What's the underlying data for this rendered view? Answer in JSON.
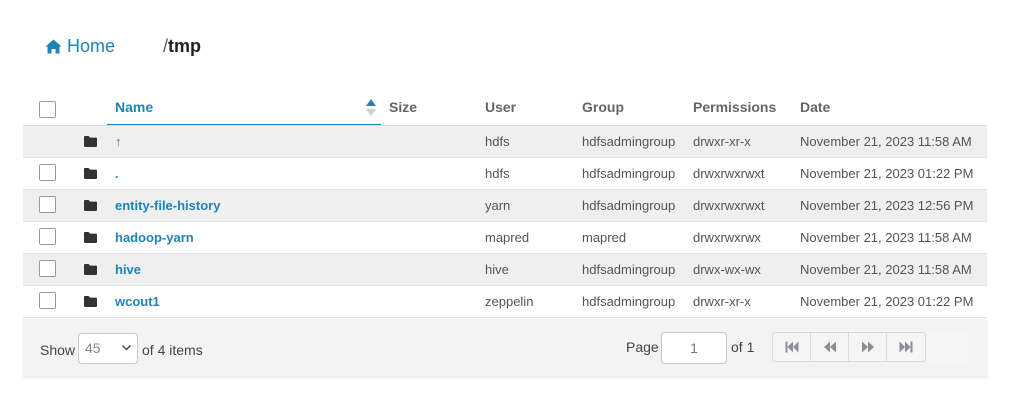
{
  "breadcrumb": {
    "home_label": "Home",
    "separator": "/",
    "current": "tmp"
  },
  "table": {
    "columns": {
      "name": "Name",
      "size": "Size",
      "user": "User",
      "group": "Group",
      "permissions": "Permissions",
      "date": "Date"
    },
    "sort": {
      "column": "Name",
      "direction": "ascending"
    },
    "rows": [
      {
        "name": "↑",
        "size": "",
        "user": "hdfs",
        "group": "hdfsadmingroup",
        "permissions": "drwxr-xr-x",
        "date": "November 21, 2023 11:58 AM",
        "type": "folder",
        "selectable": false
      },
      {
        "name": ".",
        "size": "",
        "user": "hdfs",
        "group": "hdfsadmingroup",
        "permissions": "drwxrwxrwxt",
        "date": "November 21, 2023 01:22 PM",
        "type": "folder",
        "selectable": true
      },
      {
        "name": "entity-file-history",
        "size": "",
        "user": "yarn",
        "group": "hdfsadmingroup",
        "permissions": "drwxrwxrwxt",
        "date": "November 21, 2023 12:56 PM",
        "type": "folder",
        "selectable": true
      },
      {
        "name": "hadoop-yarn",
        "size": "",
        "user": "mapred",
        "group": "mapred",
        "permissions": "drwxrwxrwx",
        "date": "November 21, 2023 11:58 AM",
        "type": "folder",
        "selectable": true
      },
      {
        "name": "hive",
        "size": "",
        "user": "hive",
        "group": "hdfsadmingroup",
        "permissions": "drwx-wx-wx",
        "date": "November 21, 2023 11:58 AM",
        "type": "folder",
        "selectable": true
      },
      {
        "name": "wcout1",
        "size": "",
        "user": "zeppelin",
        "group": "hdfsadmingroup",
        "permissions": "drwxr-xr-x",
        "date": "November 21, 2023 01:22 PM",
        "type": "folder",
        "selectable": true
      }
    ]
  },
  "footer": {
    "show_label": "Show",
    "page_size": "45",
    "items_label": "of 4 items",
    "page_label": "Page",
    "page_value": "1",
    "of_pages_label": "of 1",
    "pager_buttons": [
      "first-page-icon",
      "previous-page-icon",
      "next-page-icon",
      "last-page-icon"
    ]
  },
  "colors": {
    "accent": "#1f84b5",
    "row_alt": "#efefef",
    "footer_bg": "#f3f3f3",
    "text": "#555555"
  }
}
